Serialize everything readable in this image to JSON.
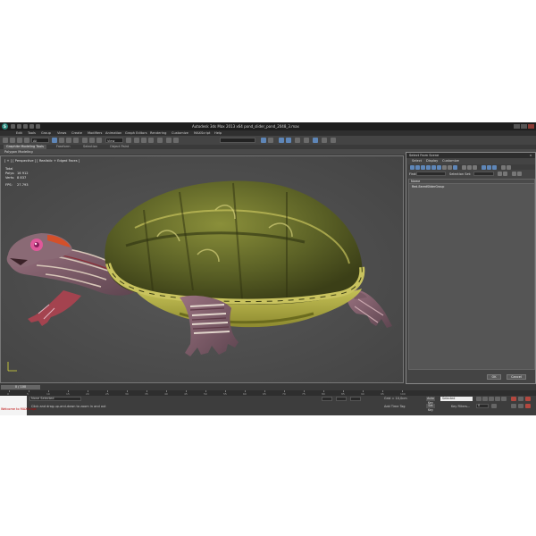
{
  "window": {
    "title": "Autodesk 3ds Max 2013 x64      pond_slider_pond_2048_3.max"
  },
  "menu": [
    "Edit",
    "Tools",
    "Group",
    "Views",
    "Create",
    "Modifiers",
    "Animation",
    "Graph Editors",
    "Rendering",
    "Customize",
    "MAXScript",
    "Help"
  ],
  "toolbar": {
    "selection_filter": "All",
    "view_dropdown": "View"
  },
  "ribbon": {
    "tabs": [
      "Graphite Modeling Tools",
      "Freeform",
      "Selection",
      "Object Paint"
    ],
    "active_tab": "Graphite Modeling Tools",
    "sub_label": "Polygon Modeling"
  },
  "viewport": {
    "label": "[ + ] [ Perspective ] [ Realistic + Edged Faces ]",
    "stats": [
      {
        "label": "Total",
        "value": ""
      },
      {
        "label": "Polys:",
        "value": "16 912"
      },
      {
        "label": "Verts:",
        "value": "8 837"
      },
      {
        "label": "FPS:",
        "value": "27.793"
      }
    ],
    "colors": {
      "background": "#4e4e4e",
      "shell": "#6f7a2a",
      "skin": "#8d6470",
      "stripe": "#d9d36a",
      "eye": "#e0589a"
    }
  },
  "dialog": {
    "title": "Select From Scene",
    "close": "x",
    "menu": [
      "Select",
      "Display",
      "Customize"
    ],
    "find_label": "Find:",
    "selection_sets_label": "Selection Set:",
    "column_header": "Name",
    "items": [
      "Red-EaredSliderGroup"
    ],
    "ok": "OK",
    "cancel": "Cancel"
  },
  "timeline": {
    "slider": "0 / 100",
    "ticks": [
      "0",
      "5",
      "10",
      "15",
      "20",
      "25",
      "30",
      "35",
      "40",
      "45",
      "50",
      "55",
      "60",
      "65",
      "70",
      "75",
      "80",
      "85",
      "90",
      "95",
      "100"
    ]
  },
  "status": {
    "maxscript": "Welcome to MAXScript",
    "selection": "None Selected",
    "prompt": "Click and drag-up-and-down to zoom in and out",
    "grid": "Grid = 10,0cm",
    "add_time_tag": "Add Time Tag",
    "auto_key": "Auto Key",
    "set_key": "Set Key",
    "selected": "Selected",
    "key_filters": "Key Filters...",
    "frame": "0"
  }
}
